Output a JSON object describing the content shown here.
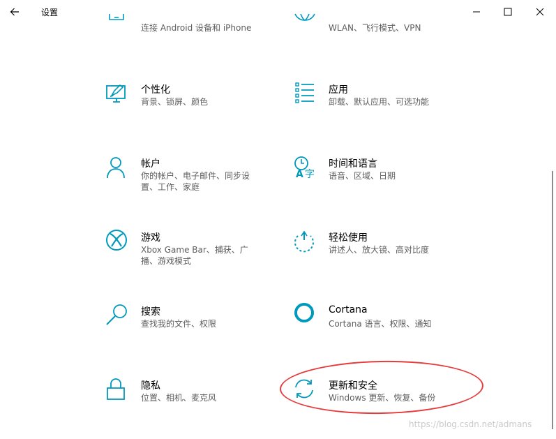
{
  "window": {
    "title": "设置",
    "back_icon": "arrow-left-icon",
    "minimize_icon": "minimize-icon",
    "maximize_icon": "maximize-icon",
    "close_icon": "close-icon"
  },
  "accent_color": "#0099bc",
  "tiles": [
    {
      "title": "",
      "desc": "连接 Android 设备和 iPhone",
      "icon": "phone-icon"
    },
    {
      "title": "",
      "desc": "WLAN、飞行模式、VPN",
      "icon": "globe-icon"
    },
    {
      "title": "个性化",
      "desc": "背景、锁屏、颜色",
      "icon": "personalization-icon"
    },
    {
      "title": "应用",
      "desc": "卸载、默认应用、可选功能",
      "icon": "apps-list-icon"
    },
    {
      "title": "帐户",
      "desc": "你的帐户、电子邮件、同步设置、工作、家庭",
      "icon": "person-icon"
    },
    {
      "title": "时间和语言",
      "desc": "语音、区域、日期",
      "icon": "time-language-icon"
    },
    {
      "title": "游戏",
      "desc": "Xbox Game Bar、捕获、广播、游戏模式",
      "icon": "xbox-icon"
    },
    {
      "title": "轻松使用",
      "desc": "讲述人、放大镜、高对比度",
      "icon": "ease-of-access-icon"
    },
    {
      "title": "搜索",
      "desc": "查找我的文件、权限",
      "icon": "search-icon"
    },
    {
      "title": "Cortana",
      "desc": "Cortana 语言、权限、通知",
      "icon": "cortana-icon"
    },
    {
      "title": "隐私",
      "desc": "位置、相机、麦克风",
      "icon": "lock-icon"
    },
    {
      "title": "更新和安全",
      "desc": "Windows 更新、恢复、备份",
      "icon": "update-sync-icon"
    }
  ],
  "watermark": "https://blog.csdn.net/admans",
  "annotation_color": "#e53b3b"
}
